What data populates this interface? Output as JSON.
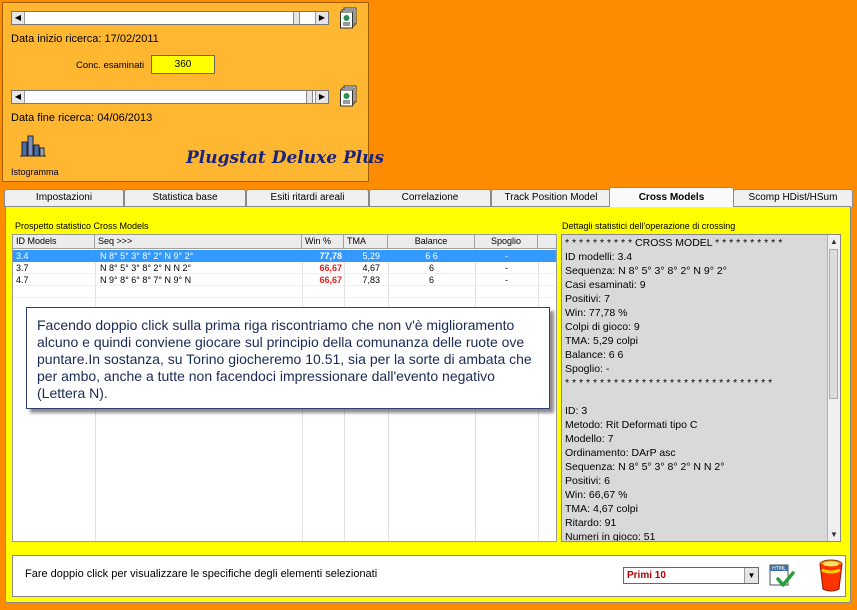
{
  "top": {
    "start_label": "Data inizio ricerca:",
    "start_date": "17/02/2011",
    "conc_label": "Conc. esaminati",
    "conc_value": "360",
    "end_label": "Data fine ricerca:",
    "end_date": "04/06/2013",
    "istogramma_label": "Istogramma",
    "brand": "Plugstat Deluxe Plus"
  },
  "tabs": [
    "Impostazioni",
    "Statistica base",
    "Esiti ritardi areali",
    "Correlazione",
    "Track Position Model",
    "Cross Models",
    "Scomp HDist/HSum"
  ],
  "active_tab": "Cross Models",
  "left_title": "Prospetto statistico Cross Models",
  "right_title": "Dettagli statistici dell'operazione di crossing",
  "grid": {
    "headers": [
      "ID Models",
      "Seq >>>",
      "Win %",
      "TMA",
      "Balance",
      "Spoglio"
    ],
    "rows": [
      {
        "id": "3.4",
        "seq": "N 8° 5° 3° 8° 2° N 9° 2°",
        "win": "77,78",
        "tma": "5,29",
        "balance": "6 6",
        "spoglio": "-"
      },
      {
        "id": "3.7",
        "seq": "N 8° 5° 3° 8° 2° N N 2°",
        "win": "66,67",
        "tma": "4,67",
        "balance": "6",
        "spoglio": "-"
      },
      {
        "id": "4.7",
        "seq": "N 9° 8° 6° 8° 7° N 9° N",
        "win": "66,67",
        "tma": "7,83",
        "balance": "6",
        "spoglio": "-"
      }
    ]
  },
  "callout": "Facendo doppio click sulla prima riga riscontriamo che non v'è miglioramento alcuno e quindi conviene giocare sul principio della comunanza delle ruote ove puntare.In sostanza, su Torino giocheremo 10.51, sia per la sorte di ambata che per ambo, anche a tutte non facendoci impressionare dall'evento negativo (Lettera N).",
  "details": [
    "* * * * * * * * * * CROSS MODEL * * * * * * * * * *",
    "ID modelli: 3.4",
    "Sequenza:  N 8° 5° 3° 8° 2° N 9° 2°",
    "Casi esaminati: 9",
    "Positivi: 7",
    "Win:  77,78 %",
    "Colpi di gioco: 9",
    "TMA:  5,29 colpi",
    "Balance: 6 6",
    "Spoglio: -",
    "* * * * * * * * * * * * * * * * * * * * * * * * * * * * * *",
    "",
    "ID: 3",
    "Metodo: Rit Deformati tipo C",
    "Modello: 7",
    "Ordinamento: DArP asc",
    "Sequenza: N 8° 5° 3° 8° 2° N N 2°",
    "Positivi: 6",
    "Win:  66,67 %",
    "TMA: 4,67 colpi",
    "Ritardo: 91",
    "Numeri in gioco: 51"
  ],
  "footer": {
    "hint": "Fare doppio click per visualizzare le specifiche degli elementi selezionati",
    "select_value": "Primi 10"
  },
  "colors": {
    "background": "#ff8c00",
    "panel": "#ffb732",
    "main": "#ffff00",
    "selected_row": "#3399ff",
    "win_red": "#e02020",
    "brand_text": "#1a237e"
  },
  "icons": [
    "document-icon",
    "document-icon",
    "histogram-icon",
    "html-export-icon",
    "eraser-bucket-icon"
  ]
}
